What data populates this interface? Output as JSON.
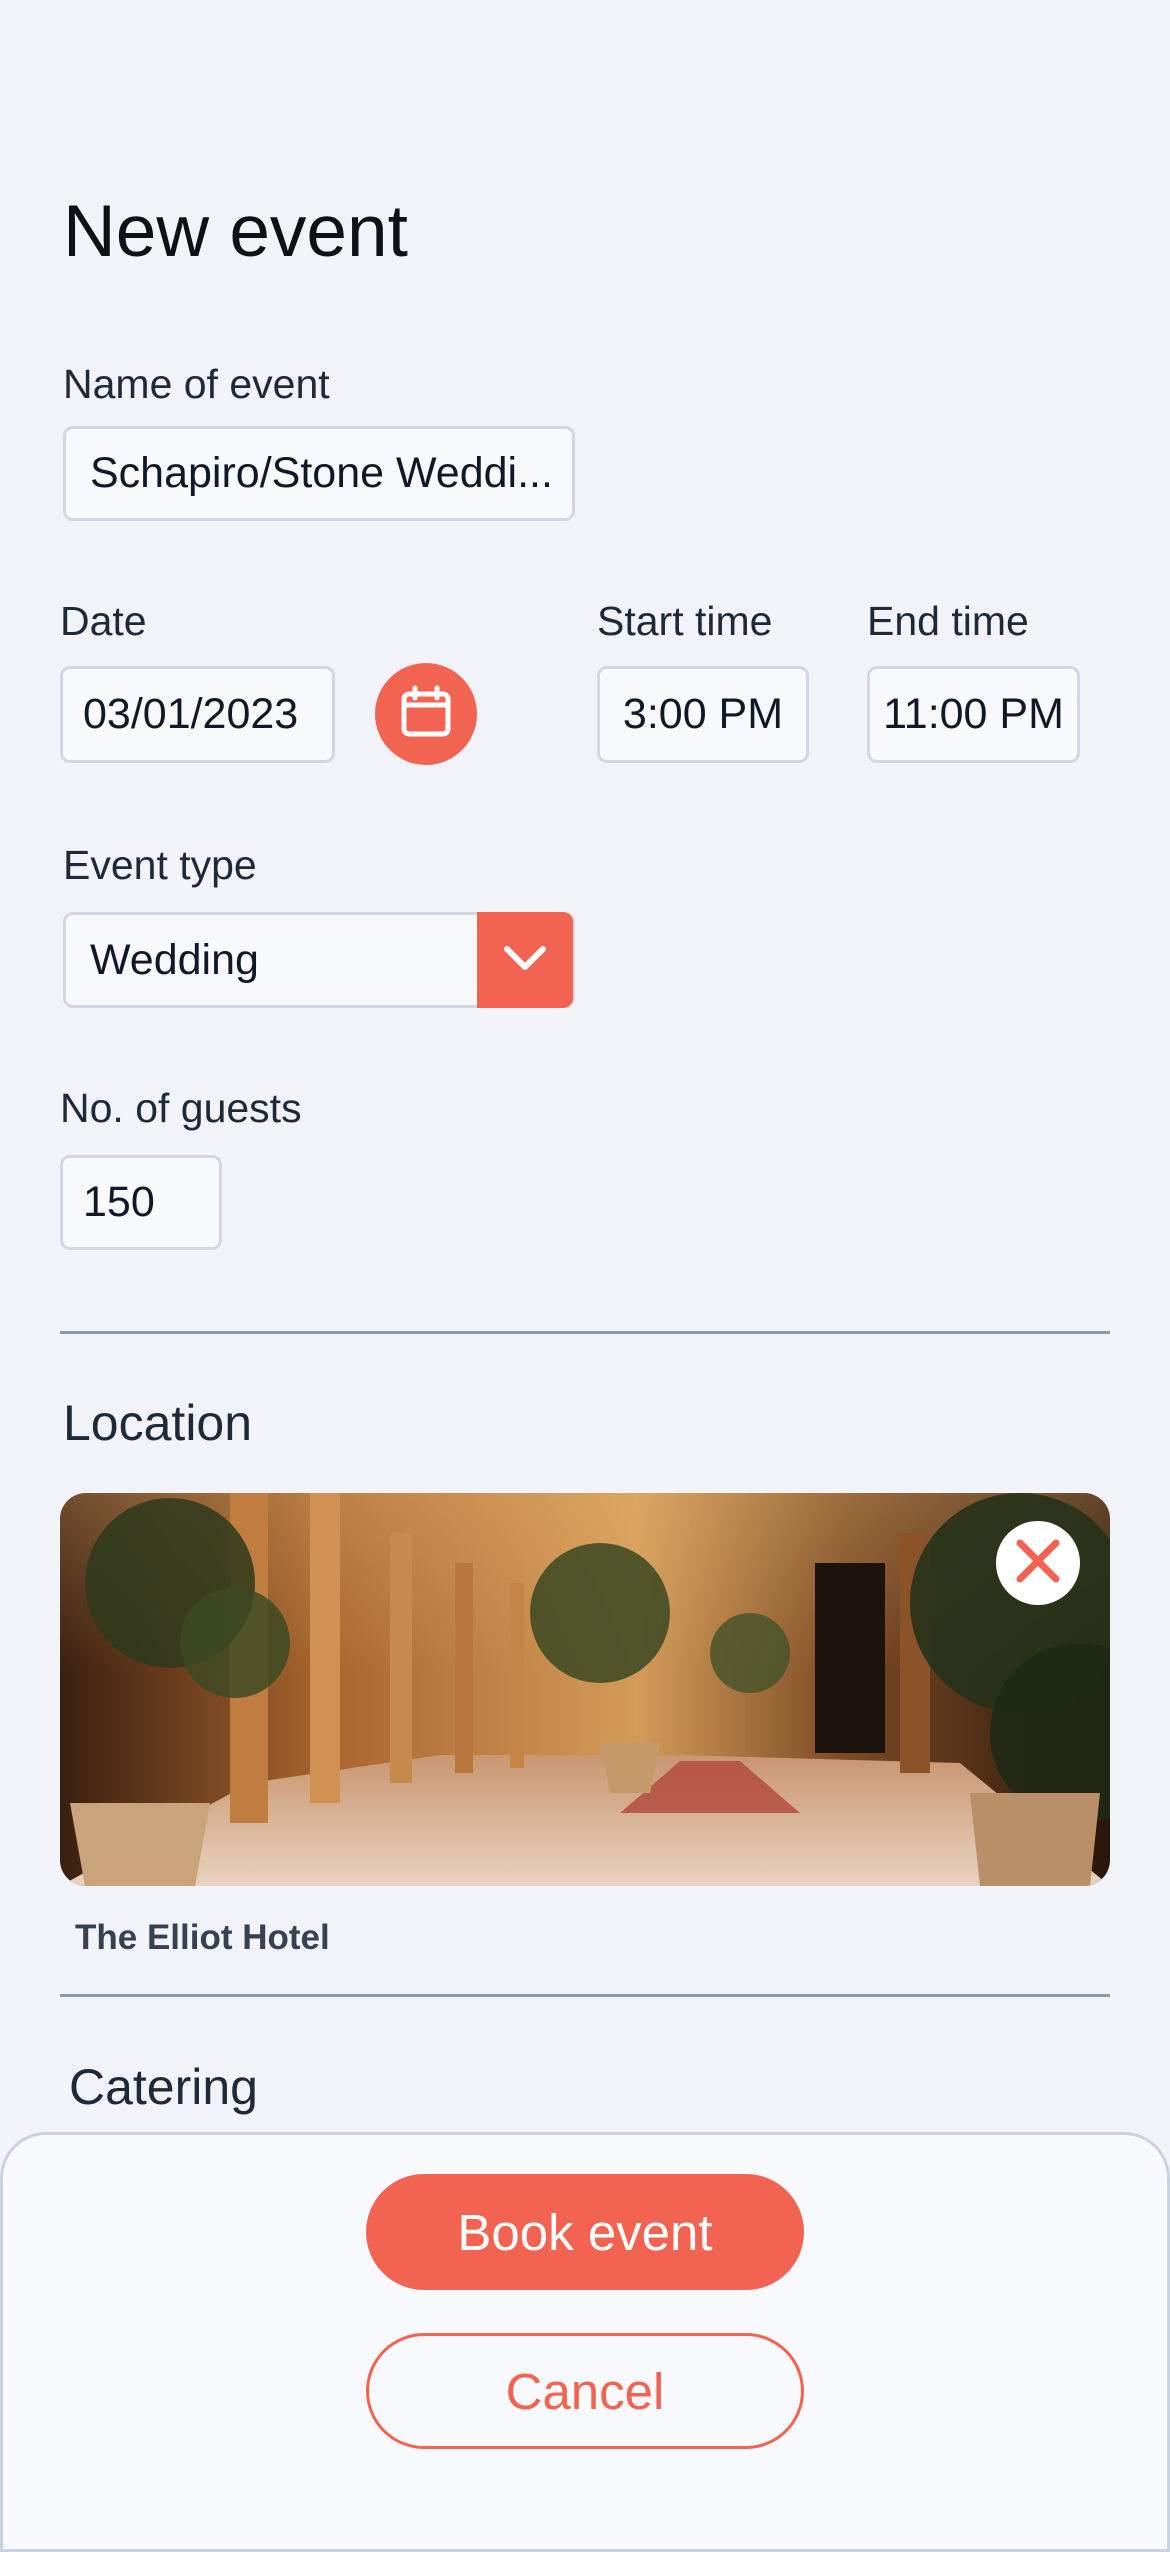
{
  "page": {
    "title": "New event"
  },
  "form": {
    "event_name": {
      "label": "Name of event",
      "value": "Schapiro/Stone Weddi..."
    },
    "date": {
      "label": "Date",
      "value": "03/01/2023",
      "icon": "calendar-icon"
    },
    "start_time": {
      "label": "Start time",
      "value": "3:00 PM"
    },
    "end_time": {
      "label": "End time",
      "value": "11:00 PM"
    },
    "event_type": {
      "label": "Event type",
      "value": "Wedding",
      "icon": "chevron-down-icon"
    },
    "guests": {
      "label": "No. of guests",
      "value": "150"
    }
  },
  "location": {
    "section_title": "Location",
    "name": "The Elliot Hotel",
    "remove_icon": "close-icon"
  },
  "catering": {
    "section_title": "Catering"
  },
  "actions": {
    "book_label": "Book event",
    "cancel_label": "Cancel"
  },
  "colors": {
    "accent": "#f26451",
    "background": "#f1f3f8",
    "field_border": "#d1d8e3",
    "divider": "#8a9aa8"
  }
}
